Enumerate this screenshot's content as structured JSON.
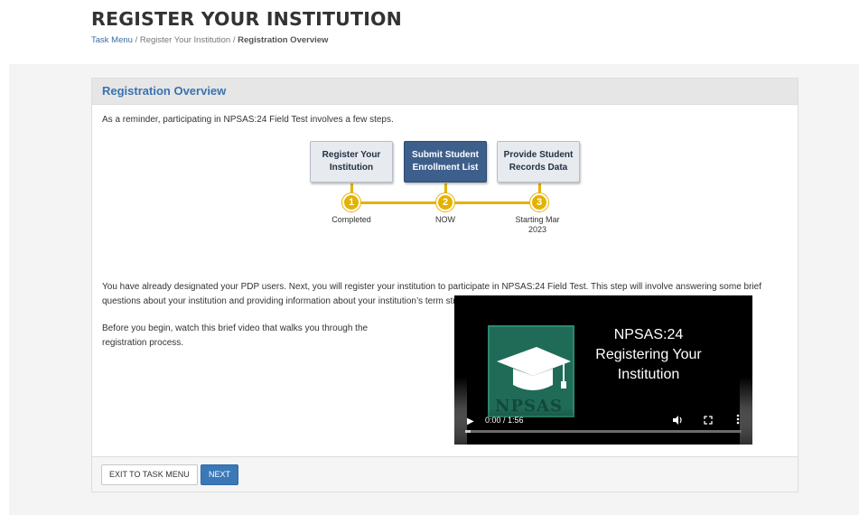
{
  "header": {
    "title": "REGISTER YOUR INSTITUTION",
    "breadcrumb": {
      "task_menu": "Task Menu",
      "sep1": "/",
      "register": "Register Your Institution",
      "sep2": "/",
      "current": "Registration Overview"
    }
  },
  "panel": {
    "heading": "Registration Overview",
    "intro": "As a reminder, participating in NPSAS:24 Field Test involves a few steps.",
    "paragraph": "You have already designated your PDP users. Next, you will register your institution to participate in NPSAS:24 Field Test. This step will involve answering some brief questions about your institution and providing information about your institution’s term structure.",
    "before_text": "Before you begin, watch this brief video that walks you through the registration process."
  },
  "steps": [
    {
      "label": "Register Your Institution",
      "number": "1",
      "status": "Completed",
      "active": false
    },
    {
      "label": "Submit Student Enrollment List",
      "number": "2",
      "status": "NOW",
      "active": true
    },
    {
      "label": "Provide Student Records Data",
      "number": "3",
      "status": "Starting Mar 2023",
      "active": false
    }
  ],
  "video": {
    "title": "NPSAS:24 Registering Your Institution",
    "logo_text": "NPSAS",
    "time": "0:00 / 1:56",
    "progress": 0.02,
    "play_icon": "play-icon",
    "volume_icon": "volume-icon",
    "fullscreen_icon": "fullscreen-icon",
    "menu_icon": "more-vertical-icon"
  },
  "footer": {
    "exit_label": "EXIT TO TASK MENU",
    "next_label": "NEXT"
  },
  "colors": {
    "accent": "#3a78b8",
    "step_active": "#3d5f8c",
    "step_connector": "#e4b200"
  }
}
